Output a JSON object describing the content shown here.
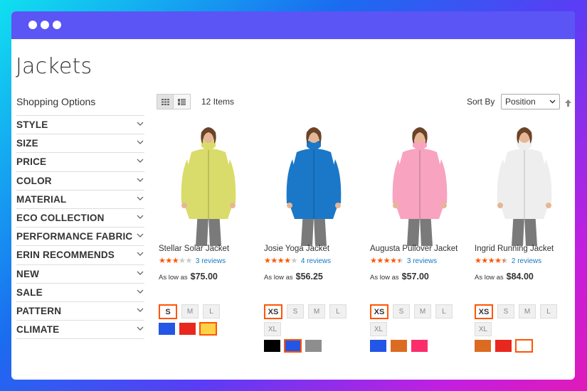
{
  "page": {
    "title": "Jackets"
  },
  "sidebar": {
    "heading": "Shopping Options",
    "filters": [
      {
        "label": "STYLE"
      },
      {
        "label": "SIZE"
      },
      {
        "label": "PRICE"
      },
      {
        "label": "COLOR"
      },
      {
        "label": "MATERIAL"
      },
      {
        "label": "ECO COLLECTION"
      },
      {
        "label": "PERFORMANCE FABRIC"
      },
      {
        "label": "ERIN RECOMMENDS"
      },
      {
        "label": "NEW"
      },
      {
        "label": "SALE"
      },
      {
        "label": "PATTERN"
      },
      {
        "label": "CLIMATE"
      }
    ]
  },
  "toolbar": {
    "items_count": "12 Items",
    "sort_label": "Sort By",
    "sort_value": "Position"
  },
  "products": [
    {
      "name": "Stellar Solar Jacket",
      "rating": 3,
      "reviews": "3 reviews",
      "price_prefix": "As low as",
      "price": "$75.00",
      "jacket_color": "#d9dc6a",
      "sizes": [
        "S",
        "M",
        "L"
      ],
      "selected_size": "S",
      "swatches": [
        "#2356e6",
        "#e8281e",
        "#fcd246"
      ],
      "selected_swatch": 2
    },
    {
      "name": "Josie Yoga Jacket",
      "rating": 4,
      "reviews": "4 reviews",
      "price_prefix": "As low as",
      "price": "$56.25",
      "jacket_color": "#1b78c8",
      "sizes": [
        "XS",
        "S",
        "M",
        "L",
        "XL"
      ],
      "selected_size": "XS",
      "swatches": [
        "#000000",
        "#2356e6",
        "#8e8e8e"
      ],
      "selected_swatch": 1
    },
    {
      "name": "Augusta Pullover Jacket",
      "rating": 4.5,
      "reviews": "3 reviews",
      "price_prefix": "As low as",
      "price": "$57.00",
      "jacket_color": "#f8a3c0",
      "sizes": [
        "XS",
        "S",
        "M",
        "L",
        "XL"
      ],
      "selected_size": "XS",
      "swatches": [
        "#2356e6",
        "#dc6b22",
        "#fb2d6b"
      ],
      "selected_swatch": -1
    },
    {
      "name": "Ingrid Running Jacket",
      "rating": 4.5,
      "reviews": "2 reviews",
      "price_prefix": "As low as",
      "price": "$84.00",
      "jacket_color": "#eeeeee",
      "sizes": [
        "XS",
        "S",
        "M",
        "L",
        "XL"
      ],
      "selected_size": "XS",
      "swatches": [
        "#dc6b22",
        "#e8281e",
        "#ffffff"
      ],
      "selected_swatch": 2
    }
  ],
  "colors": {
    "titlebar": "#5b55f5",
    "accent": "#ff5501",
    "link": "#1979c3"
  }
}
